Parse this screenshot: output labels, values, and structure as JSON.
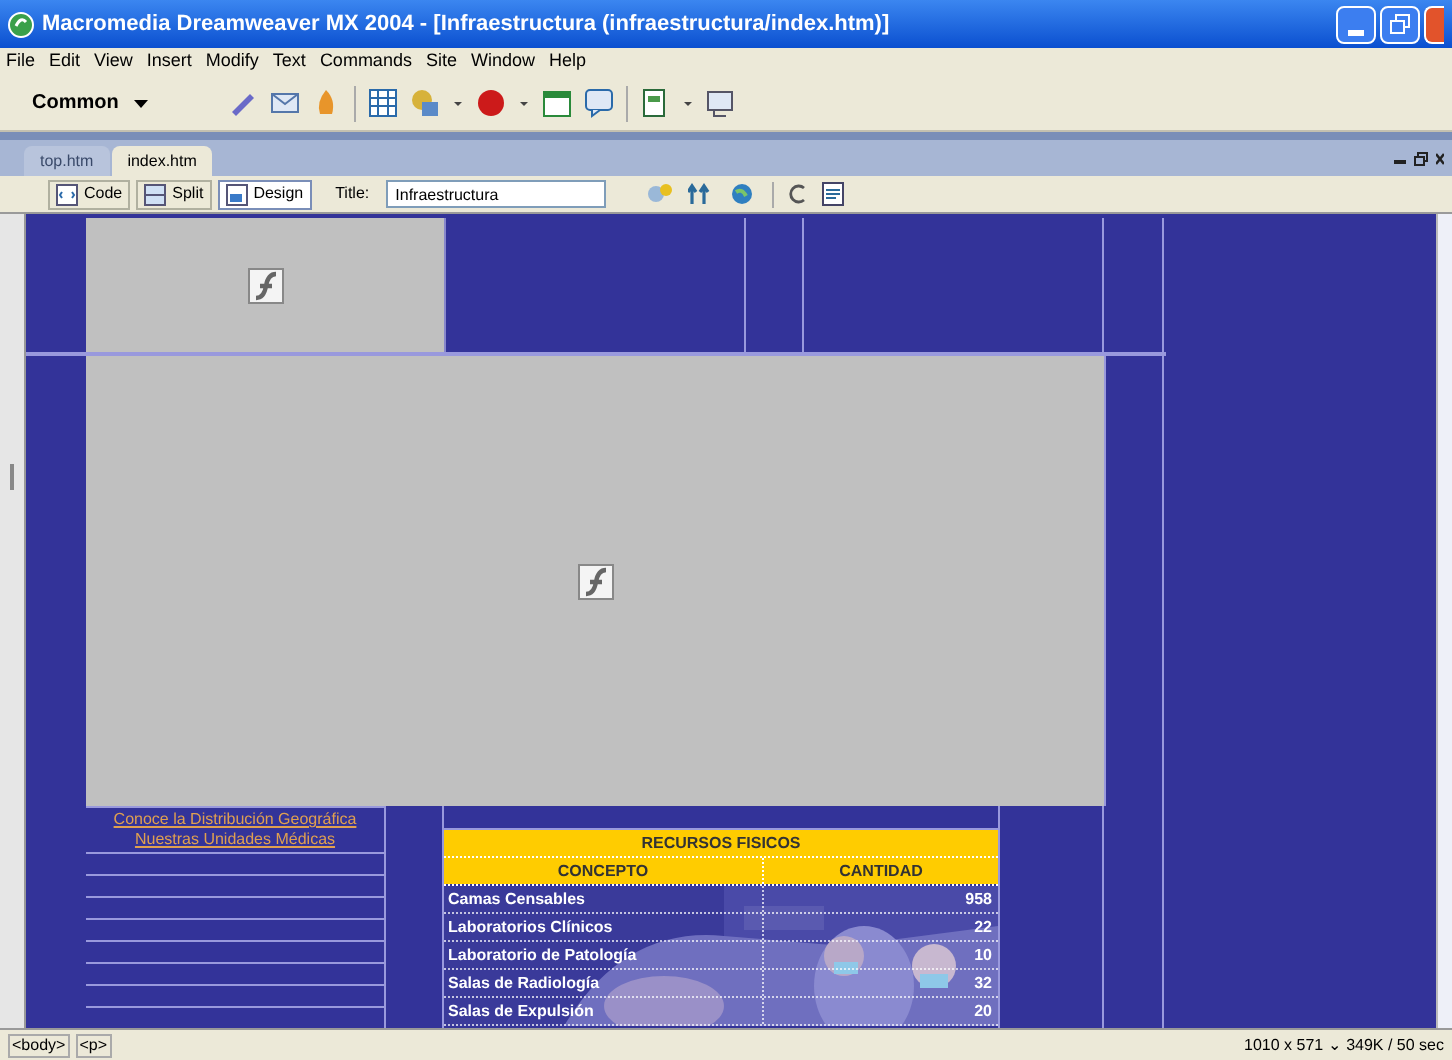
{
  "window": {
    "title": "Macromedia Dreamweaver MX 2004 - [Infraestructura (infraestructura/index.htm)]"
  },
  "menu": [
    "File",
    "Edit",
    "View",
    "Insert",
    "Modify",
    "Text",
    "Commands",
    "Site",
    "Window",
    "Help"
  ],
  "insert_bar": {
    "category": "Common"
  },
  "documents": [
    {
      "label": "top.htm",
      "selected": false
    },
    {
      "label": "index.htm",
      "selected": true
    }
  ],
  "view_buttons": [
    {
      "label": "Code",
      "selected": false
    },
    {
      "label": "Split",
      "selected": false
    },
    {
      "label": "Design",
      "selected": true
    }
  ],
  "title_field": {
    "label": "Title:",
    "value": "Infraestructura"
  },
  "page": {
    "links": [
      "Conoce la Distribución Geográfica",
      "Nuestras Unidades Médicas"
    ],
    "table": {
      "title": "RECURSOS FISICOS",
      "columns": [
        "CONCEPTO",
        "CANTIDAD"
      ],
      "rows": [
        [
          "Camas Censables",
          "958"
        ],
        [
          "Laboratorios Clínicos",
          "22"
        ],
        [
          "Laboratorio de Patología",
          "10"
        ],
        [
          "Salas de Radiología",
          "32"
        ],
        [
          "Salas de Expulsión",
          "20"
        ]
      ]
    }
  },
  "status_bar": {
    "tags": [
      "<body>",
      "<p>"
    ],
    "info": "1010 x 571 ⌄ 349K / 50 sec"
  }
}
